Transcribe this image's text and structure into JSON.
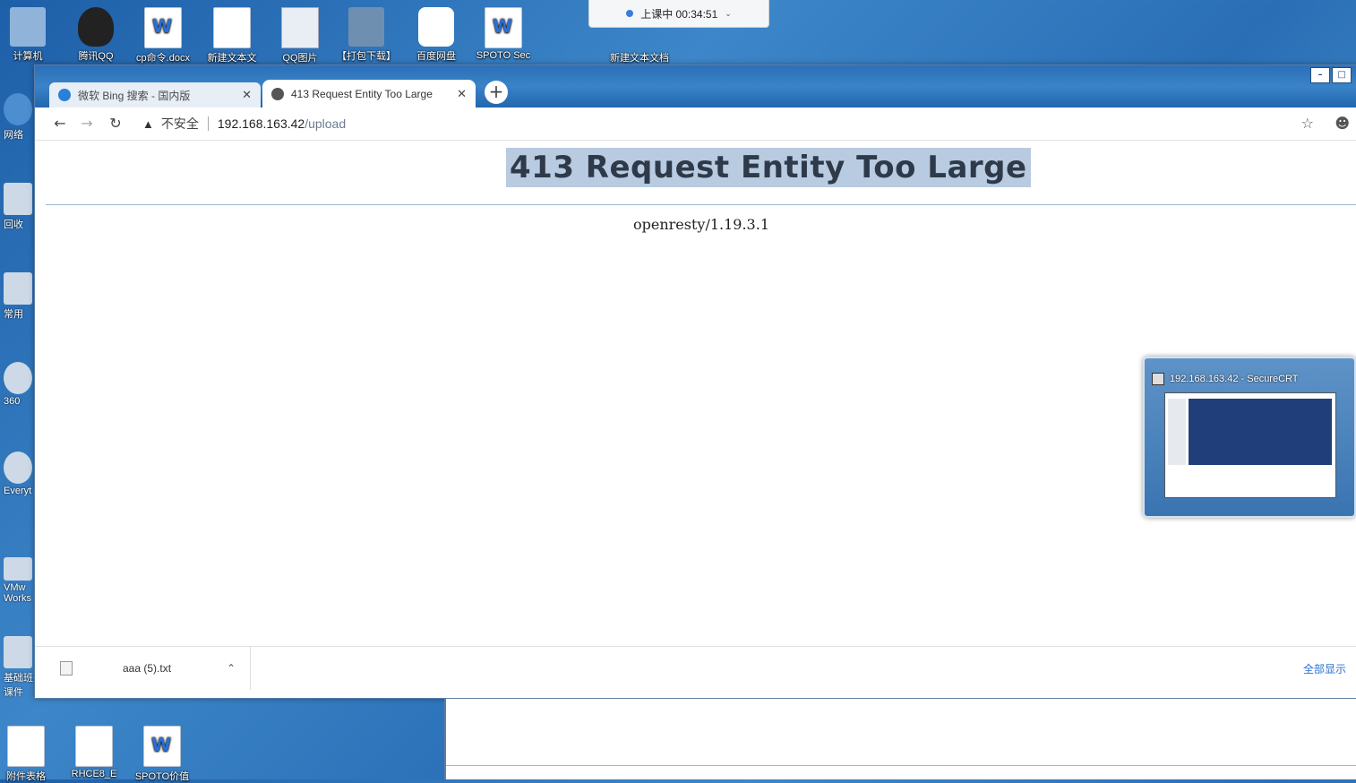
{
  "desktop": {
    "icons": [
      {
        "label": "计算机"
      },
      {
        "label": "腾讯QQ"
      },
      {
        "label": "cp命令.docx"
      },
      {
        "label": "新建文本文"
      },
      {
        "label": "QQ图片"
      },
      {
        "label": "【打包下载】"
      },
      {
        "label": "百度网盘"
      },
      {
        "label": "SPOTO Sec"
      },
      {
        "label": "新建文本文档"
      }
    ],
    "left_icons": [
      {
        "label": "网络"
      },
      {
        "label": "回收"
      },
      {
        "label": "常用"
      },
      {
        "label": "360"
      },
      {
        "label": "Everyt"
      },
      {
        "label": "VMw Works"
      },
      {
        "label": "基础班 课件"
      }
    ],
    "bottom_icons": [
      {
        "label": "附件表格"
      },
      {
        "label": "RHCE8_E"
      },
      {
        "label": "SPOTO价值"
      }
    ]
  },
  "recording": {
    "label": "上课中 00:34:51"
  },
  "browser": {
    "tabs": [
      {
        "label": "微软 Bing 搜索 - 国内版",
        "active": false
      },
      {
        "label": "413 Request Entity Too Large",
        "active": true
      }
    ],
    "address": {
      "security_label": "不安全",
      "host": "192.168.163.42",
      "path": "/upload"
    },
    "page": {
      "heading": "413 Request Entity Too Large",
      "server": "openresty/1.19.3.1"
    },
    "downloads": {
      "file": "aaa (5).txt",
      "show_all": "全部显示"
    }
  },
  "securecrt_thumb": {
    "title": "192.168.163.42 - SecureCRT"
  }
}
